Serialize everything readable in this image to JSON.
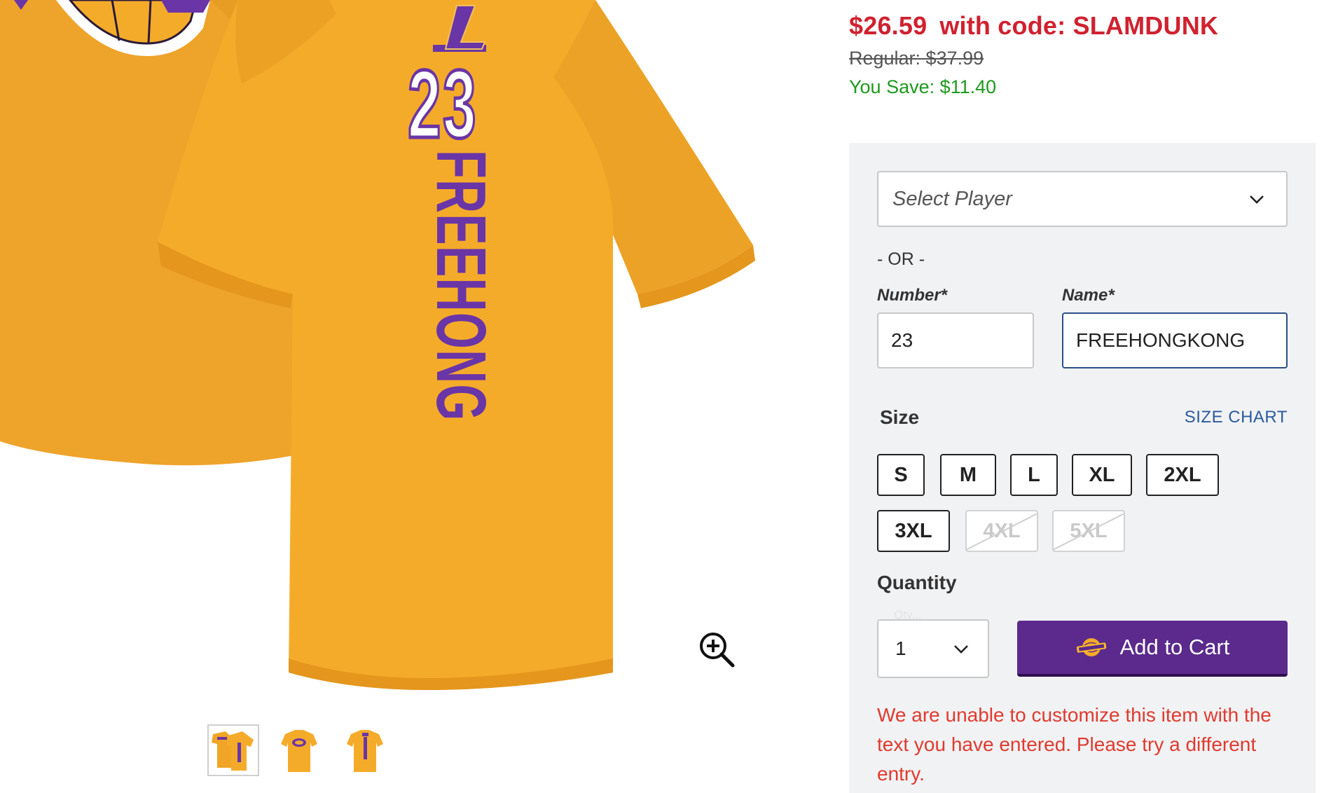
{
  "product_image": {
    "jersey_number": "23",
    "jersey_name": "FREEHONG",
    "colors": {
      "shirt": "#f5ab2a",
      "shirt_shade": "#e89d22",
      "print_purple": "#6a35a6",
      "number_white": "#ffffff"
    }
  },
  "gallery": {
    "thumbnails": [
      {
        "name": "thumb-back-front",
        "active": true
      },
      {
        "name": "thumb-front",
        "active": false
      },
      {
        "name": "thumb-back",
        "active": false
      }
    ],
    "zoom_icon": "zoom-in-icon"
  },
  "pricing": {
    "sale_price": "$26.59",
    "promo_text": "with code: SLAMDUNK",
    "regular": "Regular: $37.99",
    "you_save": "You Save: $11.40",
    "colors": {
      "sale": "#d0212f",
      "save": "#1e9a1e"
    }
  },
  "customize": {
    "select_player_placeholder": "Select Player",
    "or_text": "- OR -",
    "number_label": "Number*",
    "name_label": "Name*",
    "number_value": "23",
    "name_value": "FREEHONGKONG"
  },
  "size": {
    "label": "Size",
    "chart_link": "SIZE CHART",
    "options": [
      {
        "label": "S",
        "available": true
      },
      {
        "label": "M",
        "available": true
      },
      {
        "label": "L",
        "available": true
      },
      {
        "label": "XL",
        "available": true
      },
      {
        "label": "2XL",
        "available": true
      },
      {
        "label": "3XL",
        "available": true
      },
      {
        "label": "4XL",
        "available": false
      },
      {
        "label": "5XL",
        "available": false
      }
    ]
  },
  "quantity": {
    "label": "Quantity",
    "hint": "Qty...",
    "value": "1"
  },
  "cart": {
    "button_label": "Add to Cart",
    "button_color": "#5b2a8c",
    "icon": "lakers-logo-icon"
  },
  "error": {
    "message": "We are unable to customize this item with the text you have entered. Please try a different entry.",
    "color": "#e03a2e"
  }
}
